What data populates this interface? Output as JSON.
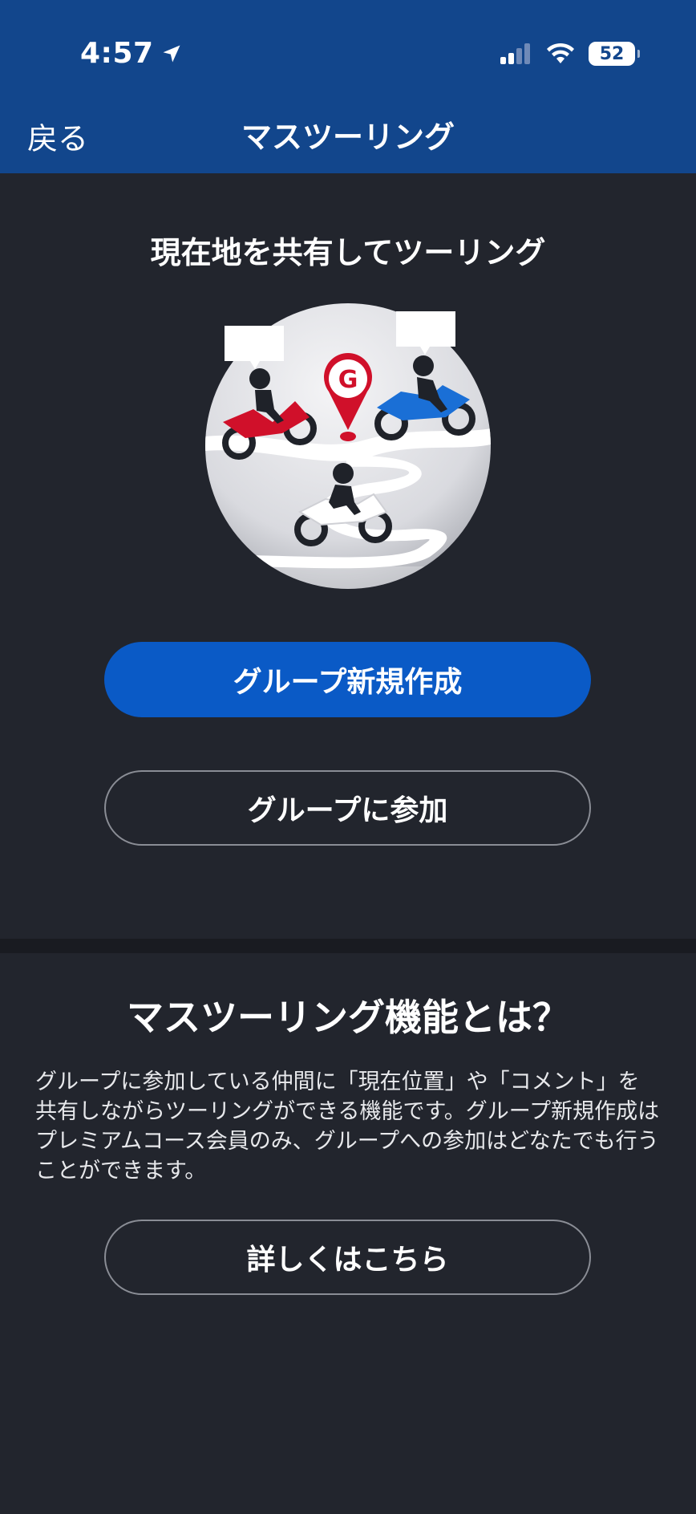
{
  "status_bar": {
    "time": "4:57",
    "battery": "52"
  },
  "nav": {
    "back_label": "戻る",
    "title": "マスツーリング"
  },
  "share_section": {
    "title": "現在地を共有してツーリング",
    "pin_letter": "G",
    "create_button": "グループ新規作成",
    "join_button": "グループに参加"
  },
  "about_section": {
    "title": "マスツーリング機能とは？",
    "description": "グループに参加している仲間に「現在位置」や「コメント」を共有しながらツーリングができる機能です。グループ新規作成はプレミアムコース会員のみ、グループへの参加はどなたでも行うことができます。",
    "details_button": "詳しくはこちら"
  },
  "colors": {
    "header": "#12468c",
    "background": "#22252d",
    "primary_button": "#0a5ac6",
    "pin": "#d0102a",
    "red_bike": "#d0102a",
    "blue_bike": "#1a6fd6"
  }
}
